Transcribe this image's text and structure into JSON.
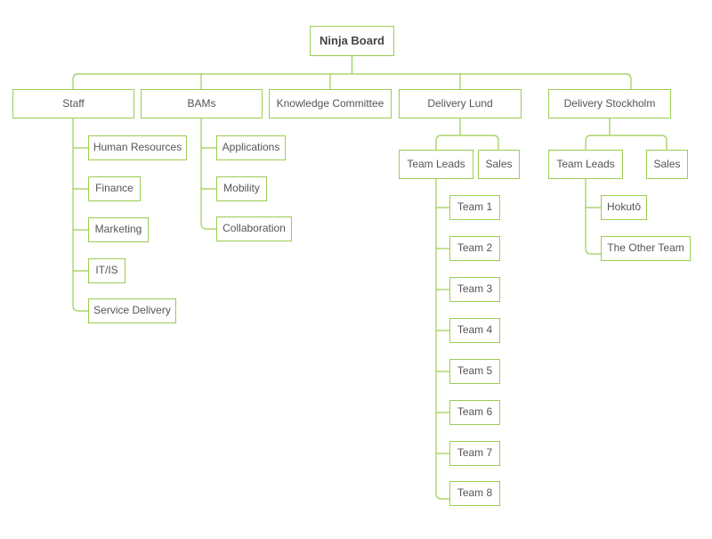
{
  "diagram": {
    "title": "Ninja Board organizational chart",
    "type": "org-chart",
    "colors": {
      "node_border": "#9ACD52",
      "edge": "#9ACD52",
      "node_background": "#ffffff",
      "text": "#555555",
      "root_text": "#444444",
      "canvas_background": "#ffffff"
    },
    "nodes": {
      "root": {
        "label": "Ninja Board"
      },
      "staff": {
        "label": "Staff"
      },
      "bams": {
        "label": "BAMs"
      },
      "knowledge_committee": {
        "label": "Knowledge Committee"
      },
      "delivery_lund": {
        "label": "Delivery Lund"
      },
      "delivery_stockholm": {
        "label": "Delivery Stockholm"
      },
      "staff_children": [
        {
          "label": "Human Resources"
        },
        {
          "label": "Finance"
        },
        {
          "label": "Marketing"
        },
        {
          "label": "IT/IS"
        },
        {
          "label": "Service Delivery"
        }
      ],
      "bams_children": [
        {
          "label": "Applications"
        },
        {
          "label": "Mobility"
        },
        {
          "label": "Collaboration"
        }
      ],
      "lund_team_leads": {
        "label": "Team Leads"
      },
      "lund_sales": {
        "label": "Sales"
      },
      "lund_teams": [
        {
          "label": "Team 1"
        },
        {
          "label": "Team 2"
        },
        {
          "label": "Team 3"
        },
        {
          "label": "Team 4"
        },
        {
          "label": "Team 5"
        },
        {
          "label": "Team 6"
        },
        {
          "label": "Team 7"
        },
        {
          "label": "Team 8"
        }
      ],
      "stockholm_team_leads": {
        "label": "Team Leads"
      },
      "stockholm_sales": {
        "label": "Sales"
      },
      "stockholm_teams": [
        {
          "label": "Hokutō"
        },
        {
          "label": "The Other Team"
        }
      ]
    }
  }
}
